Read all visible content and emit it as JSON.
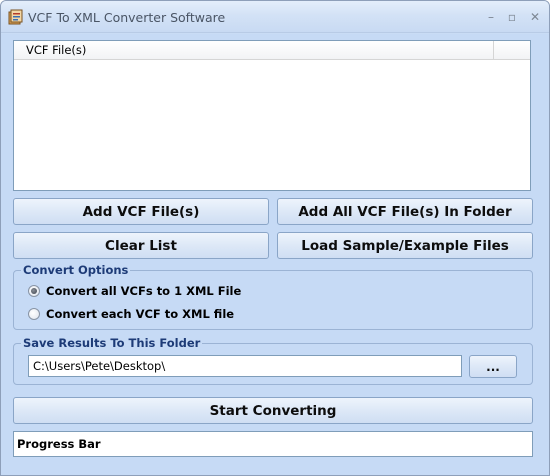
{
  "window": {
    "title": "VCF To XML Converter Software",
    "controls": {
      "minimize": "–",
      "maximize": "▫",
      "close": "✕"
    }
  },
  "file_list": {
    "columns": [
      "VCF File(s)"
    ],
    "rows": []
  },
  "buttons": {
    "add_files": "Add VCF File(s)",
    "add_folder": "Add All VCF File(s) In Folder",
    "clear_list": "Clear List",
    "load_sample": "Load Sample/Example Files",
    "browse": "...",
    "start": "Start Converting"
  },
  "convert_options": {
    "legend": "Convert Options",
    "options": [
      {
        "label": "Convert all VCFs to 1 XML File",
        "selected": true
      },
      {
        "label": "Convert each VCF to XML file",
        "selected": false
      }
    ]
  },
  "save_folder": {
    "legend": "Save Results To This Folder",
    "path": "C:\\Users\\Pete\\Desktop\\"
  },
  "progress": {
    "label": "Progress Bar",
    "value": 0
  },
  "colors": {
    "window_bg": "#c6daf5",
    "group_legend": "#1d3b77",
    "border": "#7f9db9"
  }
}
